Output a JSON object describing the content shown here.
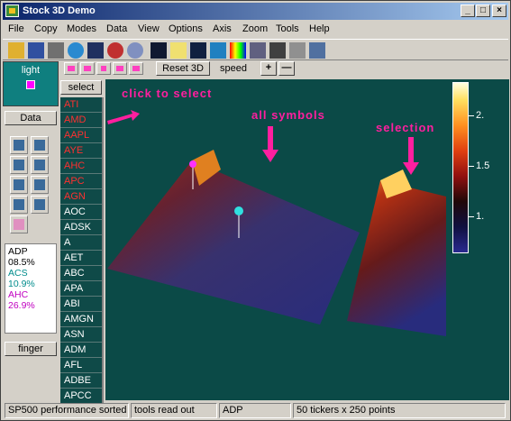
{
  "window": {
    "title": "Stock 3D Demo",
    "controls": {
      "minimize": "_",
      "maximize": "□",
      "close": "×"
    }
  },
  "menu": [
    "File",
    "Copy",
    "Modes",
    "Data",
    "View",
    "Options",
    "Axis",
    "Zoom",
    "Tools",
    "Help"
  ],
  "toolbar": {
    "icons": [
      "open-icon",
      "save-icon",
      "print-icon",
      "globe-icon",
      "camera-icon",
      "zoom-in-icon",
      "zoom-out-icon",
      "light-icon",
      "spotlight-icon",
      "color-icon",
      "palette-icon",
      "rainbow-icon",
      "shading-icon",
      "text-icon",
      "cursor-icon",
      "table-icon"
    ]
  },
  "left_panel": {
    "light_label": "light",
    "light_color": "#ff00ff",
    "data_button": "Data",
    "readout": [
      {
        "symbol": "ADP",
        "value": "08.5%",
        "color": "#000000"
      },
      {
        "symbol": "ACS",
        "value": "10.9%",
        "color": "#008c8c"
      },
      {
        "symbol": "AHC",
        "value": "26.9%",
        "color": "#c000c0"
      }
    ],
    "finger_button": "finger"
  },
  "playback": {
    "reset_button": "Reset 3D",
    "speed_label": "speed",
    "plus": "+",
    "minus": "—"
  },
  "symbols": {
    "select_button": "select",
    "items": [
      {
        "label": "ATI",
        "selected": true
      },
      {
        "label": "AMD",
        "selected": true
      },
      {
        "label": "AAPL",
        "selected": true
      },
      {
        "label": "AYE",
        "selected": true
      },
      {
        "label": "AHC",
        "selected": true
      },
      {
        "label": "APC",
        "selected": true
      },
      {
        "label": "AGN",
        "selected": true
      },
      {
        "label": "AOC",
        "selected": false
      },
      {
        "label": "ADSK",
        "selected": false
      },
      {
        "label": "A",
        "selected": false
      },
      {
        "label": "AET",
        "selected": false
      },
      {
        "label": "ABC",
        "selected": false
      },
      {
        "label": "APA",
        "selected": false
      },
      {
        "label": "ABI",
        "selected": false
      },
      {
        "label": "AMGN",
        "selected": false
      },
      {
        "label": "ASN",
        "selected": false
      },
      {
        "label": "ADM",
        "selected": false
      },
      {
        "label": "AFL",
        "selected": false
      },
      {
        "label": "ADBE",
        "selected": false
      },
      {
        "label": "APCC",
        "selected": false
      }
    ]
  },
  "view": {
    "annotations": {
      "click_to_select": "click to select",
      "all_symbols": "all symbols",
      "selection": "selection"
    },
    "colorbar_ticks": [
      "2.",
      "1.5",
      "1."
    ],
    "accent": "#ff1f9f",
    "background": "#0b4a47"
  },
  "status": {
    "cells": [
      "SP500 performance sorted",
      "tools read out",
      "ADP",
      "50 tickers x 250 points"
    ]
  }
}
